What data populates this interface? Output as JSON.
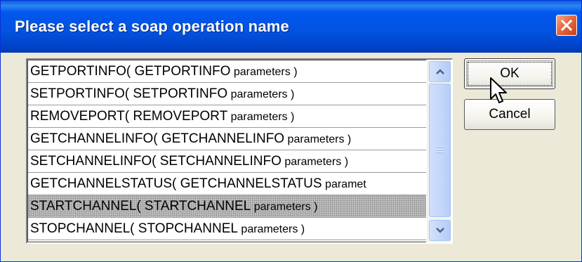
{
  "dialog": {
    "title": "Please select a soap operation name",
    "close_icon": "close-icon",
    "ok_label": "OK",
    "cancel_label": "Cancel"
  },
  "list": {
    "items": [
      {
        "name": "GETPORTINFO( GETPORTINFO",
        "params": " parameters )"
      },
      {
        "name": "SETPORTINFO( SETPORTINFO",
        "params": " parameters )"
      },
      {
        "name": "REMOVEPORT( REMOVEPORT",
        "params": " parameters )"
      },
      {
        "name": "GETCHANNELINFO( GETCHANNELINFO",
        "params": " parameters )"
      },
      {
        "name": "SETCHANNELINFO( SETCHANNELINFO",
        "params": " parameters )"
      },
      {
        "name": "GETCHANNELSTATUS( GETCHANNELSTATUS",
        "params": " paramet"
      },
      {
        "name": "STARTCHANNEL( STARTCHANNEL",
        "params": " parameters )"
      },
      {
        "name": "STOPCHANNEL( STOPCHANNEL",
        "params": " parameters )"
      }
    ],
    "selected_index": 6
  },
  "colors": {
    "titlebar": "#0058ee",
    "close_button": "#e66a3f",
    "dialog_bg": "#ece9d8",
    "selection_bg": "#c0c0c0"
  },
  "icons": {
    "scroll_up": "chevron-up-icon",
    "scroll_down": "chevron-down-icon",
    "cursor": "mouse-pointer-icon"
  }
}
